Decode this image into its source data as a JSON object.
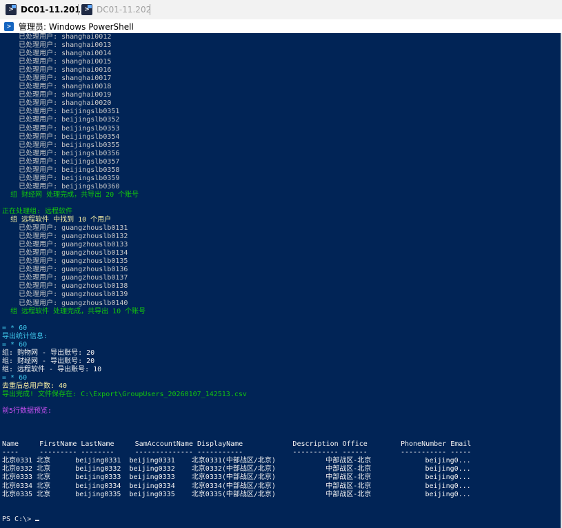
{
  "tabs": [
    {
      "label": "DC01-11.201",
      "active": true
    },
    {
      "label": "DC01-11.202",
      "active": false
    }
  ],
  "window_title": "管理员: Windows PowerShell",
  "colors": {
    "console_bg": "#012456",
    "green": "#13c60d",
    "yellow": "#f9f1a5",
    "cyan": "#3fc6ea",
    "magenta": "#c950f2"
  },
  "console_lines": [
    {
      "text": "    已处理用户: shanghai0012",
      "color": "gray"
    },
    {
      "text": "    已处理用户: shanghai0013",
      "color": "gray"
    },
    {
      "text": "    已处理用户: shanghai0014",
      "color": "gray"
    },
    {
      "text": "    已处理用户: shanghai0015",
      "color": "gray"
    },
    {
      "text": "    已处理用户: shanghai0016",
      "color": "gray"
    },
    {
      "text": "    已处理用户: shanghai0017",
      "color": "gray"
    },
    {
      "text": "    已处理用户: shanghai0018",
      "color": "gray"
    },
    {
      "text": "    已处理用户: shanghai0019",
      "color": "gray"
    },
    {
      "text": "    已处理用户: shanghai0020",
      "color": "gray"
    },
    {
      "text": "    已处理用户: beijingslb0351",
      "color": "gray"
    },
    {
      "text": "    已处理用户: beijingslb0352",
      "color": "gray"
    },
    {
      "text": "    已处理用户: beijingslb0353",
      "color": "gray"
    },
    {
      "text": "    已处理用户: beijingslb0354",
      "color": "gray"
    },
    {
      "text": "    已处理用户: beijingslb0355",
      "color": "gray"
    },
    {
      "text": "    已处理用户: beijingslb0356",
      "color": "gray"
    },
    {
      "text": "    已处理用户: beijingslb0357",
      "color": "gray"
    },
    {
      "text": "    已处理用户: beijingslb0358",
      "color": "gray"
    },
    {
      "text": "    已处理用户: beijingslb0359",
      "color": "gray"
    },
    {
      "text": "    已处理用户: beijingslb0360",
      "color": "gray"
    },
    {
      "text": "  组 财经网 处理完成，共导出 20 个账号",
      "color": "green"
    },
    {
      "text": "",
      "color": "white"
    },
    {
      "text": "正在处理组: 远程软件",
      "color": "green"
    },
    {
      "text": "  组 远程软件 中找到 10 个用户",
      "color": "yellow"
    },
    {
      "text": "    已处理用户: guangzhouslb0131",
      "color": "gray"
    },
    {
      "text": "    已处理用户: guangzhouslb0132",
      "color": "gray"
    },
    {
      "text": "    已处理用户: guangzhouslb0133",
      "color": "gray"
    },
    {
      "text": "    已处理用户: guangzhouslb0134",
      "color": "gray"
    },
    {
      "text": "    已处理用户: guangzhouslb0135",
      "color": "gray"
    },
    {
      "text": "    已处理用户: guangzhouslb0136",
      "color": "gray"
    },
    {
      "text": "    已处理用户: guangzhouslb0137",
      "color": "gray"
    },
    {
      "text": "    已处理用户: guangzhouslb0138",
      "color": "gray"
    },
    {
      "text": "    已处理用户: guangzhouslb0139",
      "color": "gray"
    },
    {
      "text": "    已处理用户: guangzhouslb0140",
      "color": "gray"
    },
    {
      "text": "  组 远程软件 处理完成，共导出 10 个账号",
      "color": "green"
    },
    {
      "text": "",
      "color": "white"
    },
    {
      "text": "= * 60",
      "color": "cyan"
    },
    {
      "text": "导出统计信息:",
      "color": "cyan"
    },
    {
      "text": "= * 60",
      "color": "cyan"
    },
    {
      "text": "组: 购物网 - 导出账号: 20",
      "color": "white"
    },
    {
      "text": "组: 财经网 - 导出账号: 20",
      "color": "white"
    },
    {
      "text": "组: 远程软件 - 导出账号: 10",
      "color": "white"
    },
    {
      "text": "= * 60",
      "color": "cyan"
    },
    {
      "text": "去重后总用户数: 40",
      "color": "yellow"
    },
    {
      "text": "导出完成! 文件保存在: C:\\Export\\GroupUsers_20260107_142513.csv",
      "color": "green"
    },
    {
      "text": "",
      "color": "white"
    },
    {
      "text": "前5行数据预览:",
      "color": "magenta"
    },
    {
      "text": "",
      "color": "white"
    },
    {
      "text": "",
      "color": "white"
    },
    {
      "text": "",
      "color": "white"
    },
    {
      "text": "Name     FirstName LastName     SamAccountName DisplayName            Description Office        PhoneNumber Email",
      "color": "white"
    },
    {
      "text": "----     --------- --------     -------------- -----------            ----------- ------        ----------- -----",
      "color": "white"
    },
    {
      "text": "北京0331 北京      beijing0331  beijing0331    北京0331(中部战区/北京)            中部战区-北京             beijing0...",
      "color": "white"
    },
    {
      "text": "北京0332 北京      beijing0332  beijing0332    北京0332(中部战区/北京)            中部战区-北京             beijing0...",
      "color": "white"
    },
    {
      "text": "北京0333 北京      beijing0333  beijing0333    北京0333(中部战区/北京)            中部战区-北京             beijing0...",
      "color": "white"
    },
    {
      "text": "北京0334 北京      beijing0334  beijing0334    北京0334(中部战区/北京)            中部战区-北京             beijing0...",
      "color": "white"
    },
    {
      "text": "北京0335 北京      beijing0335  beijing0335    北京0335(中部战区/北京)            中部战区-北京             beijing0...",
      "color": "white"
    },
    {
      "text": "",
      "color": "white"
    },
    {
      "text": "",
      "color": "white"
    }
  ],
  "prompt": "PS C:\\> "
}
